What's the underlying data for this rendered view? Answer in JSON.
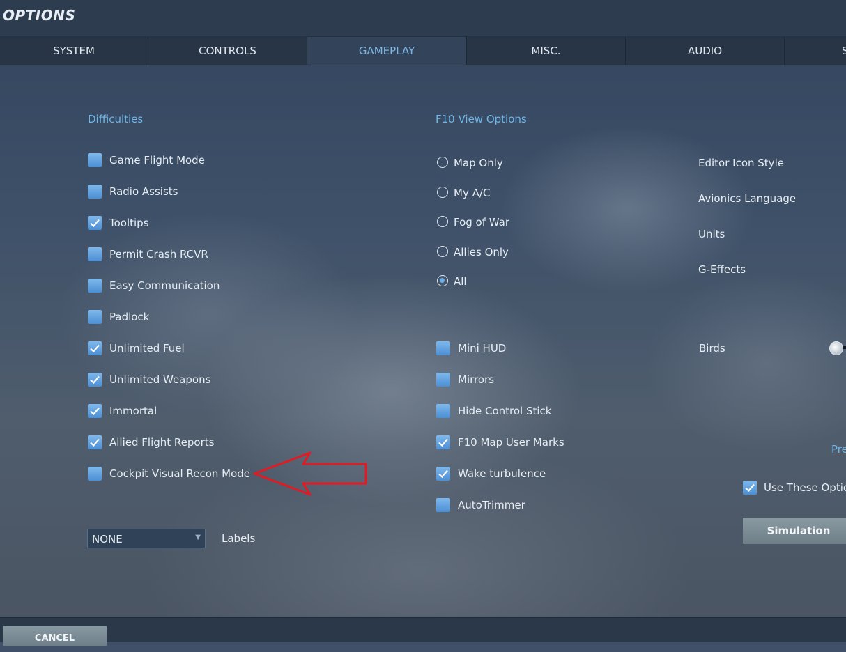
{
  "window": {
    "title": "OPTIONS"
  },
  "tabs": [
    {
      "label": "SYSTEM",
      "active": false
    },
    {
      "label": "CONTROLS",
      "active": false
    },
    {
      "label": "GAMEPLAY",
      "active": true
    },
    {
      "label": "MISC.",
      "active": false
    },
    {
      "label": "AUDIO",
      "active": false
    },
    {
      "label": "S",
      "active": false
    }
  ],
  "difficulties": {
    "title": "Difficulties",
    "items": [
      {
        "label": "Game Flight Mode",
        "checked": false
      },
      {
        "label": "Radio Assists",
        "checked": false
      },
      {
        "label": "Tooltips",
        "checked": true
      },
      {
        "label": "Permit Crash RCVR",
        "checked": false
      },
      {
        "label": "Easy Communication",
        "checked": false
      },
      {
        "label": "Padlock",
        "checked": false
      },
      {
        "label": "Unlimited Fuel",
        "checked": true
      },
      {
        "label": "Unlimited Weapons",
        "checked": true
      },
      {
        "label": "Immortal",
        "checked": true
      },
      {
        "label": "Allied Flight Reports",
        "checked": true
      },
      {
        "label": "Cockpit Visual Recon Mode",
        "checked": false
      }
    ],
    "labels_dropdown": {
      "value": "NONE",
      "label": "Labels"
    }
  },
  "f10": {
    "title": "F10 View Options",
    "radios": [
      {
        "label": "Map Only",
        "selected": false
      },
      {
        "label": "My A/C",
        "selected": false
      },
      {
        "label": "Fog of War",
        "selected": false
      },
      {
        "label": "Allies Only",
        "selected": false
      },
      {
        "label": "All",
        "selected": true
      }
    ],
    "checkboxes": [
      {
        "label": "Mini HUD",
        "checked": false
      },
      {
        "label": "Mirrors",
        "checked": false
      },
      {
        "label": "Hide Control Stick",
        "checked": false
      },
      {
        "label": "F10 Map User Marks",
        "checked": true
      },
      {
        "label": "Wake turbulence",
        "checked": true
      },
      {
        "label": "AutoTrimmer",
        "checked": false
      }
    ]
  },
  "right": {
    "editor_icon_style": "Editor Icon Style",
    "avionics_language": "Avionics Language",
    "units": "Units",
    "g_effects": "G-Effects",
    "birds": "Birds",
    "presets_label": "Pre",
    "use_these_options": {
      "label": "Use These Optio",
      "checked": true
    },
    "simulation_button": "Simulation"
  },
  "footer": {
    "cancel": "CANCEL"
  },
  "colors": {
    "accent_blue": "#6fb7e8",
    "checkbox": "#5b9fe0",
    "annotation_arrow": "#e01b24"
  }
}
